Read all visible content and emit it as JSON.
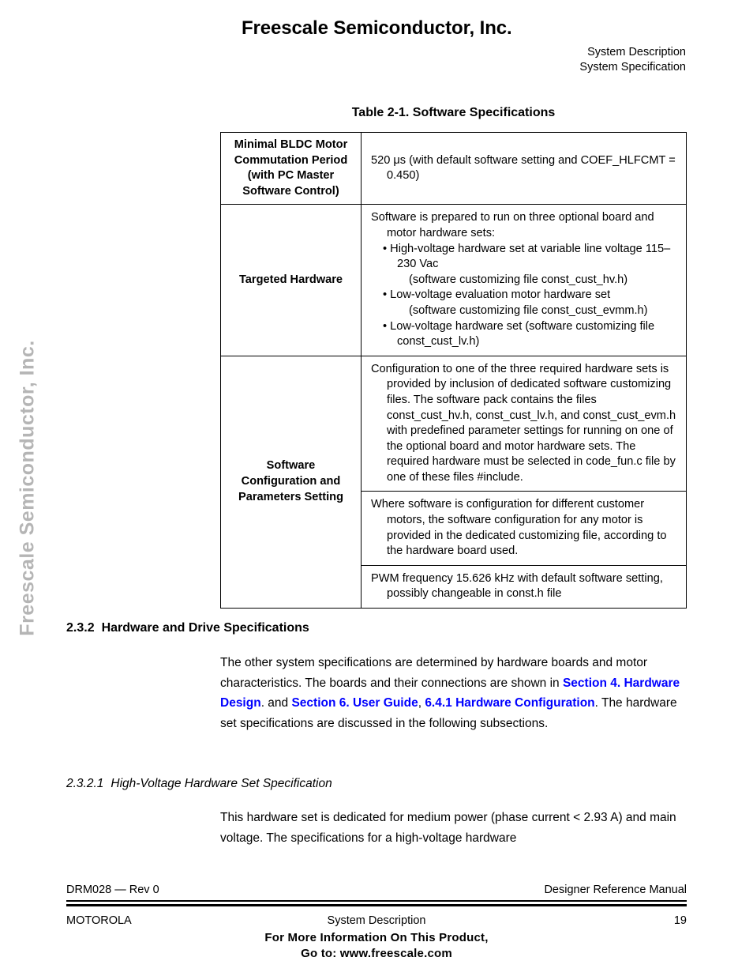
{
  "watermark": {
    "text": "Freescale Semiconductor, Inc.",
    "color": "#b5b5b5"
  },
  "header": {
    "brand_title": "Freescale Semiconductor, Inc.",
    "right_line_1": "System Description",
    "right_line_2": "System Specification"
  },
  "table": {
    "caption": "Table 2-1. Software Specifications",
    "rows": [
      {
        "label": "Minimal BLDC Motor Commutation Period (with PC Master Software Control)",
        "value_lines": [
          "520 μs (with default software setting and COEF_HLFCMT = 0.450)"
        ]
      },
      {
        "label": "Targeted Hardware",
        "value_lines": [
          "Software is prepared to run on three optional board and motor hardware sets:",
          "• High-voltage hardware set at variable line voltage 115–230 Vac",
          "(software customizing file const_cust_hv.h)",
          "• Low-voltage evaluation motor hardware set",
          "(software customizing file const_cust_evmm.h)",
          "• Low-voltage hardware set (software customizing file const_cust_lv.h)"
        ]
      },
      {
        "label": "Software Configuration and Parameters Setting",
        "value_blocks": [
          "Configuration to one of the three required hardware sets is provided by inclusion of dedicated software customizing files. The software pack contains the files const_cust_hv.h, const_cust_lv.h, and const_cust_evm.h with predefined parameter settings for running on one of the optional board and motor hardware sets. The required hardware must be selected in code_fun.c file by one of these files #include.",
          "Where software is configuration for different customer motors, the software configuration for any motor is provided in the dedicated customizing file, according to the hardware board used.",
          "PWM frequency 15.626 kHz with default software setting, possibly changeable in const.h file"
        ]
      }
    ]
  },
  "sections": {
    "section_2_3_2": {
      "number": "2.3.2",
      "title": "Hardware and Drive Specifications",
      "paragraph": {
        "part_1": "The other system specifications are determined by hardware boards and motor characteristics. The boards and their connections are shown in ",
        "link_1": "Section 4. Hardware Design",
        "part_2": ". and ",
        "link_2": "Section 6. User Guide",
        "part_3": ", ",
        "link_3": "6.4.1 Hardware Configuration",
        "part_4": ". The hardware set specifications are discussed in the following subsections."
      }
    },
    "section_2_3_2_1": {
      "number": "2.3.2.1",
      "title": "High-Voltage Hardware Set Specification",
      "paragraph": "This hardware set is dedicated for medium power (phase current < 2.93 A) and main voltage. The specifications for a high-voltage hardware"
    }
  },
  "footer": {
    "doc_id": "DRM028 — Rev 0",
    "manual_type": "Designer Reference Manual",
    "company": "MOTOROLA",
    "chapter": "System Description",
    "page_number": "19",
    "promo_line_1": "For More Information On This Product,",
    "promo_line_2": "Go to: www.freescale.com"
  },
  "colors": {
    "link_blue": "#0000ff",
    "text_black": "#000000",
    "watermark_gray": "#b5b5b5"
  }
}
